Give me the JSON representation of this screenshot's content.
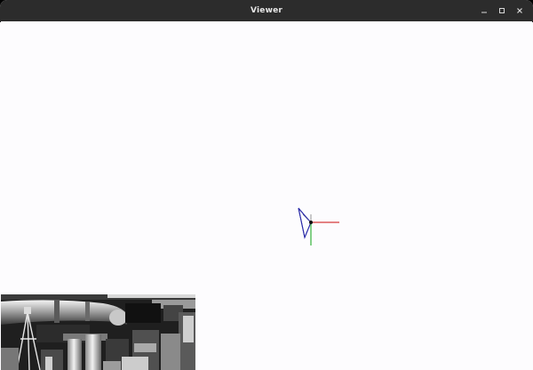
{
  "window": {
    "title": "Viewer"
  },
  "titlebar": {
    "controls": [
      {
        "name": "minimize",
        "icon": "minimize-icon"
      },
      {
        "name": "maximize",
        "icon": "maximize-icon"
      },
      {
        "name": "close",
        "icon": "close-icon"
      }
    ]
  },
  "scene": {
    "axis_colors": {
      "x": "#d63a3a",
      "y": "#33b43a",
      "camera_frustum": "#2a2aa8"
    },
    "background": "#fdfcfe"
  },
  "camera_feed": {
    "icon": "camera-image",
    "style": "grayscale"
  }
}
